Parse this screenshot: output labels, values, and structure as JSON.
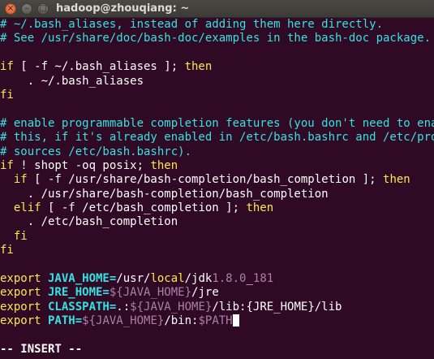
{
  "window": {
    "title": "hadoop@zhouqiang: ~",
    "close_glyph": "×",
    "min_glyph": "–",
    "max_glyph": "□"
  },
  "lines": {
    "l1": "# ~/.bash_aliases, instead of adding them here directly.",
    "l2": "# See /usr/share/doc/bash-doc/examples in the bash-doc package.",
    "l4_kw1": "if",
    "l4_mid": " [ -f ~/.bash_aliases ]; ",
    "l4_kw2": "then",
    "l5": "    . ~/.bash_aliases",
    "l6": "fi",
    "l8": "# enable programmable completion features (you don't need to enable",
    "l9": "# this, if it's already enabled in /etc/bash.bashrc and /etc/profile",
    "l10": "# sources /etc/bash.bashrc).",
    "l11_kw1": "if",
    "l11_mid": " ! shopt -oq posix; ",
    "l11_kw2": "then",
    "l12_indent": "  ",
    "l12_kw1": "if",
    "l12_mid": " [ -f /usr/share/bash-completion/bash_completion ]; ",
    "l12_kw2": "then",
    "l13": "    . /usr/share/bash-completion/bash_completion",
    "l14_indent": "  ",
    "l14_kw1": "elif",
    "l14_mid": " [ -f /etc/bash_completion ]; ",
    "l14_kw2": "then",
    "l15": "    . /etc/bash_completion",
    "l16": "  fi",
    "l17": "fi",
    "l19_kw": "export",
    "l19_var": " JAVA_HOME=",
    "l19_a": "/usr/",
    "l19_b": "local",
    "l19_c": "/jdk",
    "l19_d": "1.8.0",
    "l19_e": "_",
    "l19_f": "181",
    "l20_kw": "export",
    "l20_var": " JRE_HOME=",
    "l20_sub": "${JAVA_HOME}",
    "l20_rest": "/jre",
    "l21_kw": "export",
    "l21_var": " CLASSPATH=",
    "l21_a": ".:",
    "l21_sub": "${JAVA_HOME}",
    "l21_rest": "/lib:{JRE_HOME}/lib",
    "l22_kw": "export",
    "l22_var": " PATH=",
    "l22_sub1": "${JAVA_HOME}",
    "l22_mid": "/bin:",
    "l22_sub2": "$PATH",
    "status": "-- INSERT --"
  }
}
